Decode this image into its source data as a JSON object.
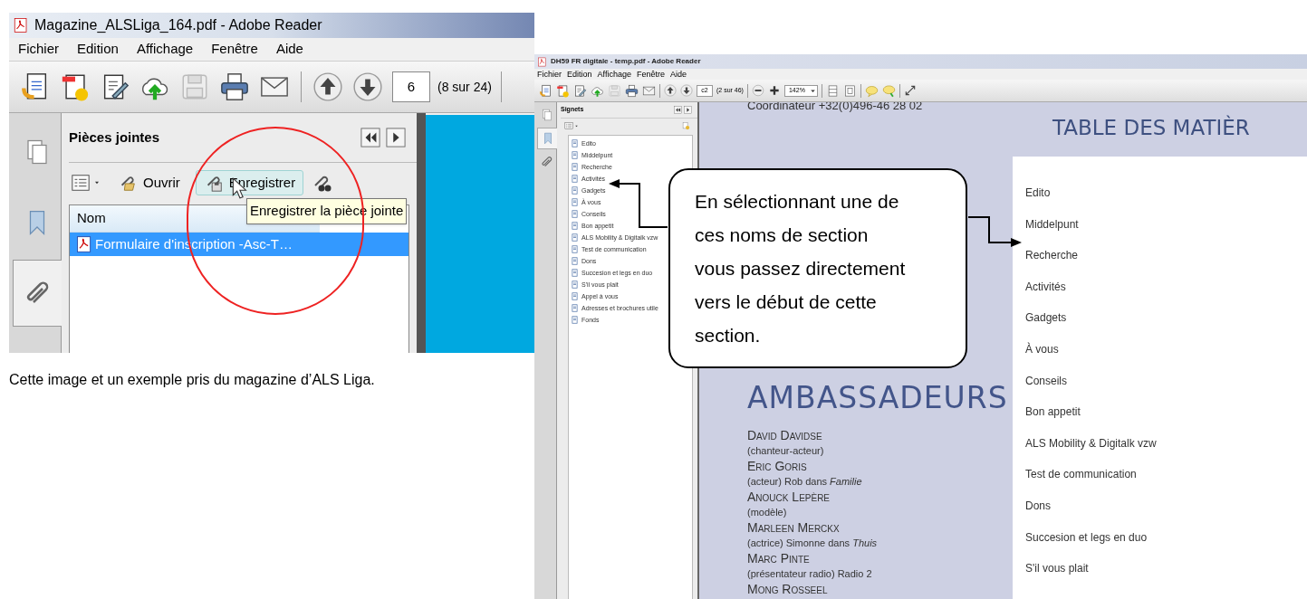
{
  "left_window": {
    "title": "Magazine_ALSLiga_164.pdf - Adobe Reader",
    "menu": [
      "Fichier",
      "Edition",
      "Affichage",
      "Fenêtre",
      "Aide"
    ],
    "page_field": "6",
    "page_count": "(8 sur 24)",
    "nav_tabs": [
      {
        "kind": "pages",
        "selected": false
      },
      {
        "kind": "bookmarks",
        "selected": false
      },
      {
        "kind": "attachments",
        "selected": true
      }
    ],
    "panel_title": "Pièces jointes",
    "panel_buttons": [
      {
        "label": "Ouvrir",
        "kind": "open",
        "hovered": false
      },
      {
        "label": "Enregistrer",
        "kind": "save",
        "hovered": true
      }
    ],
    "column": "Nom",
    "attachments": [
      {
        "name": "Formulaire d'inscription -Asc-T…",
        "selected": true
      }
    ],
    "tooltip": "Enregistrer la pièce jointe"
  },
  "caption": "Cette image et un exemple pris du magazine d’ALS Liga.",
  "right_window": {
    "title": "DH59 FR digitale - temp.pdf - Adobe Reader",
    "menu": [
      "Fichier",
      "Edition",
      "Affichage",
      "Fenêtre",
      "Aide"
    ],
    "page_field": "c2",
    "page_count": "(2 sur 46)",
    "zoom": "142%",
    "nav_tabs": [
      {
        "kind": "pages",
        "selected": false
      },
      {
        "kind": "bookmarks",
        "selected": true
      },
      {
        "kind": "attachments",
        "selected": false
      }
    ],
    "panel_title": "Signets",
    "bookmarks": [
      "Edito",
      "Middelpunt",
      "Recherche",
      "Activités",
      "Gadgets",
      "À vous",
      "Conseils",
      "Bon appetit",
      "ALS Mobility & Digitalk vzw",
      "Test de communication",
      "Dons",
      "Succesion et legs en duo",
      "S'il vous plait",
      "Appel à vous",
      "Adresses et brochures utile",
      "Fonds"
    ],
    "document": {
      "contact": "Coordinateur +32(0)496-46 28 02",
      "toc_title": "TABLE DES MATIÈR",
      "toc": [
        "Edito",
        "Middelpunt",
        "Recherche",
        "Activités",
        "Gadgets",
        "À vous",
        "Conseils",
        "Bon appetit",
        "ALS Mobility & Digitalk vzw",
        "Test de communication",
        "Dons",
        "Succesion et legs en duo",
        "S'il vous plait"
      ],
      "ambassadors_title": "AMBASSADEURS",
      "ambassadors": [
        {
          "name": "David Davidse",
          "role": "(chanteur-acteur)"
        },
        {
          "name": "Eric Goris",
          "role": "(acteur) Rob dans *Familie*"
        },
        {
          "name": "Anouck Lepère",
          "role": "(modèle)"
        },
        {
          "name": "Marleen Merckx",
          "role": "(actrice) Simonne dans *Thuis*"
        },
        {
          "name": "Marc Pinte",
          "role": "(présentateur radio) Radio 2"
        },
        {
          "name": "Mong Rosseel"
        }
      ]
    }
  },
  "callout": {
    "text": "En sélectionnant une de ces noms de section vous passez directement vers le début de cette section."
  }
}
